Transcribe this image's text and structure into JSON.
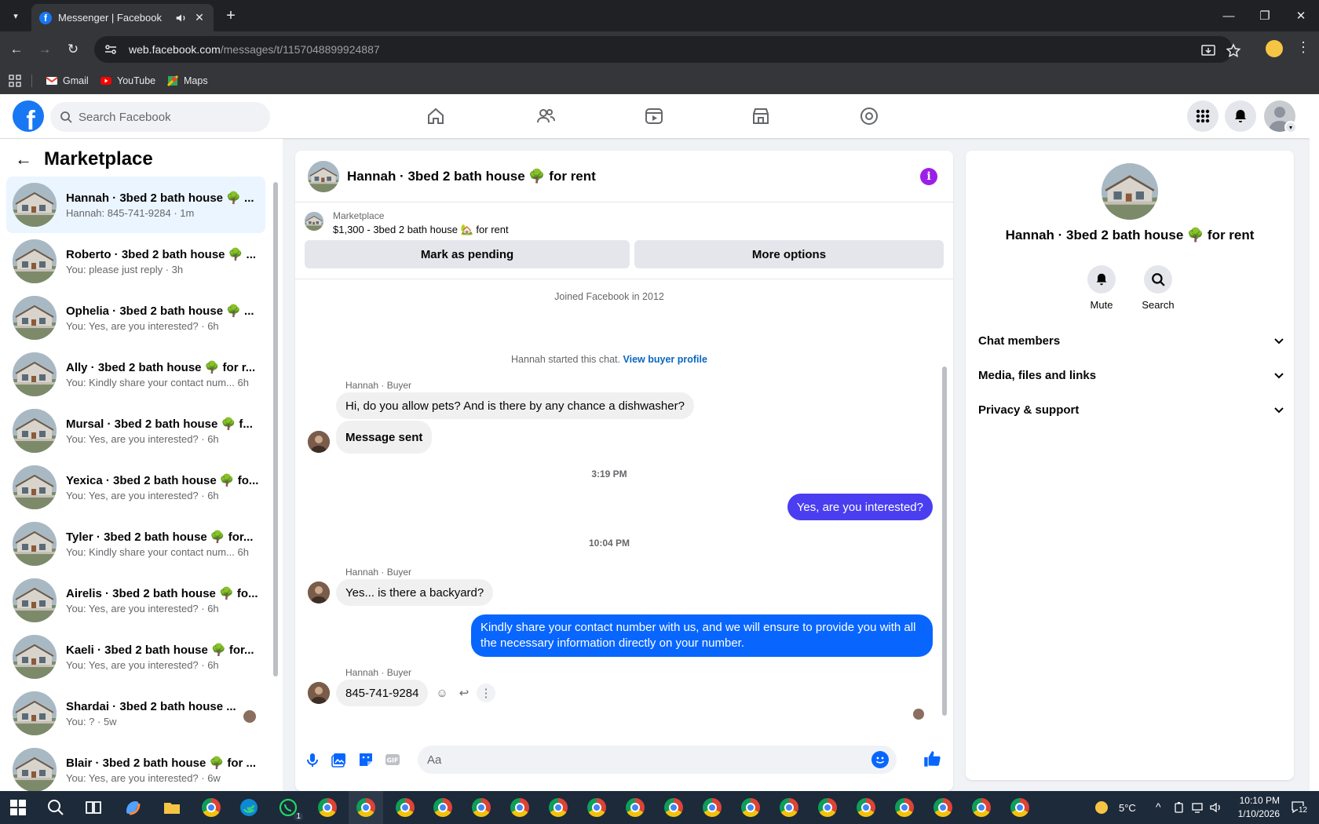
{
  "browser": {
    "tab_title": "Messenger | Facebook",
    "url_host": "web.facebook.com",
    "url_path": "/messages/t/1157048899924887",
    "bookmarks": [
      "Gmail",
      "YouTube",
      "Maps"
    ]
  },
  "fb": {
    "search_placeholder": "Search Facebook"
  },
  "left": {
    "title": "Marketplace",
    "chats": [
      {
        "name": "Hannah · 3bed 2 bath house 🌳 ...",
        "sub": "Hannah: 845-741-9284 · 1m"
      },
      {
        "name": "Roberto · 3bed 2 bath house 🌳 ...",
        "sub": "You: please just reply · 3h"
      },
      {
        "name": "Ophelia · 3bed 2 bath house 🌳 ...",
        "sub": "You: Yes, are you interested? · 6h"
      },
      {
        "name": "Ally · 3bed 2 bath house 🌳 for r...",
        "sub": "You: Kindly share your contact num...  6h"
      },
      {
        "name": "Mursal · 3bed 2 bath house 🌳 f...",
        "sub": "You: Yes, are you interested? · 6h"
      },
      {
        "name": "Yexica · 3bed 2 bath house 🌳 fo...",
        "sub": "You: Yes, are you interested? · 6h"
      },
      {
        "name": "Tyler · 3bed 2 bath house 🌳 for...",
        "sub": "You: Kindly share your contact num...  6h"
      },
      {
        "name": "Airelis · 3bed 2 bath house 🌳 fo...",
        "sub": "You: Yes, are you interested? · 6h"
      },
      {
        "name": "Kaeli · 3bed 2 bath house 🌳 for...",
        "sub": "You: Yes, are you interested? · 6h"
      },
      {
        "name": "Shardai · 3bed 2 bath house ...",
        "sub": "You: ? · 5w"
      },
      {
        "name": "Blair · 3bed 2 bath house 🌳 for ...",
        "sub": "You: Yes, are you interested? · 6w"
      }
    ]
  },
  "chat": {
    "title": "Hannah · 3bed 2 bath house 🌳 for rent",
    "marketplace_label": "Marketplace",
    "listing": "$1,300 - 3bed 2 bath house 🏡 for rent",
    "mark_pending": "Mark as pending",
    "more_options": "More options",
    "joined": "Joined Facebook in 2012",
    "started_text": "Hannah started this chat.",
    "view_profile": "View buyer profile",
    "sender_label": "Hannah · Buyer",
    "msg1": "Hi, do you allow pets? And is there by any chance a dishwasher?",
    "msg2": "Message sent",
    "time1": "3:19 PM",
    "out1": "Yes, are you interested?",
    "time2": "10:04 PM",
    "msg3": "Yes... is there a backyard?",
    "out2": "Kindly share your contact number with us, and we will ensure to provide you with all the necessary information directly on your number.",
    "msg4": "845-741-9284",
    "composer_placeholder": "Aa"
  },
  "right": {
    "name": "Hannah · 3bed 2 bath house 🌳 for rent",
    "mute": "Mute",
    "search": "Search",
    "sections": [
      "Chat members",
      "Media, files and links",
      "Privacy & support"
    ]
  },
  "taskbar": {
    "weather": "5°C",
    "time": "10:10 PM",
    "date": "1/10/2026",
    "notif_count": "12",
    "whatsapp_badge": "1"
  },
  "colors": {
    "fb_blue": "#1877f2",
    "outgoing_bubble": "#4a3ef0",
    "info_purple": "#9b1fe8"
  }
}
